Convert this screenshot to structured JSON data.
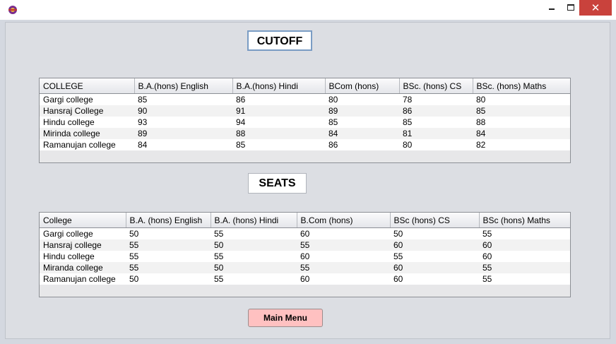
{
  "titlebar": {
    "minimize_glyph": "—",
    "maximize_glyph": "□",
    "close_glyph": "✕"
  },
  "cutoff": {
    "heading": "CUTOFF",
    "columns": [
      "COLLEGE",
      "B.A.(hons) English",
      "B.A.(hons) Hindi",
      "BCom (hons)",
      "BSc. (hons) CS",
      "BSc. (hons) Maths"
    ],
    "rows": [
      [
        "Gargi college",
        "85",
        "86",
        "80",
        "78",
        "80"
      ],
      [
        "Hansraj College",
        "90",
        "91",
        "89",
        "86",
        "85"
      ],
      [
        "Hindu college",
        "93",
        "94",
        "85",
        "85",
        "88"
      ],
      [
        "Mirinda college",
        "89",
        "88",
        "84",
        "81",
        "84"
      ],
      [
        "Ramanujan college",
        "84",
        "85",
        "86",
        "80",
        "82"
      ]
    ]
  },
  "seats": {
    "heading": "SEATS",
    "columns": [
      "College",
      "B.A. (hons) English",
      "B.A. (hons) Hindi",
      "B.Com (hons)",
      "BSc (hons) CS",
      "BSc (hons) Maths"
    ],
    "rows": [
      [
        "Gargi college",
        "50",
        "55",
        "60",
        "50",
        "55"
      ],
      [
        "Hansraj college",
        "55",
        "50",
        "55",
        "60",
        "60"
      ],
      [
        "Hindu college",
        "55",
        "55",
        "60",
        "55",
        "60"
      ],
      [
        "Miranda college",
        "55",
        "50",
        "55",
        "60",
        "55"
      ],
      [
        "Ramanujan college",
        "50",
        "55",
        "60",
        "60",
        "55"
      ]
    ]
  },
  "main_menu_label": "Main Menu",
  "colors": {
    "close_button": "#c9423c",
    "main_menu_button": "#ffc1c1",
    "cutoff_heading_border": "#7a9cc4"
  }
}
